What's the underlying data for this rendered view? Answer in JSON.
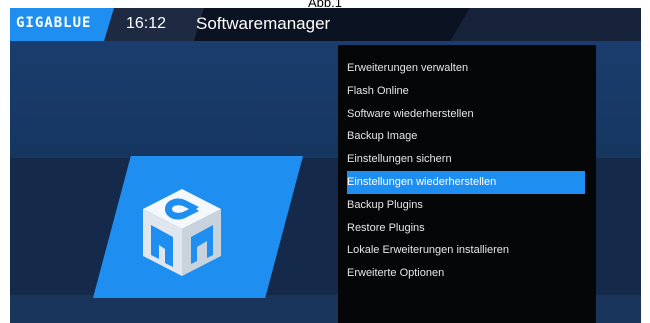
{
  "caption": "Abb.1",
  "header": {
    "logo": "GIGABLUE",
    "time": "16:12",
    "title": "Softwaremanager"
  },
  "menu": {
    "selected_index": 5,
    "items": [
      {
        "label": "Erweiterungen verwalten"
      },
      {
        "label": "Flash Online"
      },
      {
        "label": "Software wiederherstellen"
      },
      {
        "label": "Backup Image"
      },
      {
        "label": "Einstellungen sichern"
      },
      {
        "label": "Einstellungen wiederherstellen"
      },
      {
        "label": "Backup Plugins"
      },
      {
        "label": "Restore Plugins"
      },
      {
        "label": "Lokale Erweiterungen installieren"
      },
      {
        "label": "Erweiterte Optionen"
      }
    ]
  },
  "icon": "software-cube-icon",
  "colors": {
    "accent": "#1e8ff0",
    "background": "#12213d",
    "menu_bg": "#050608"
  }
}
